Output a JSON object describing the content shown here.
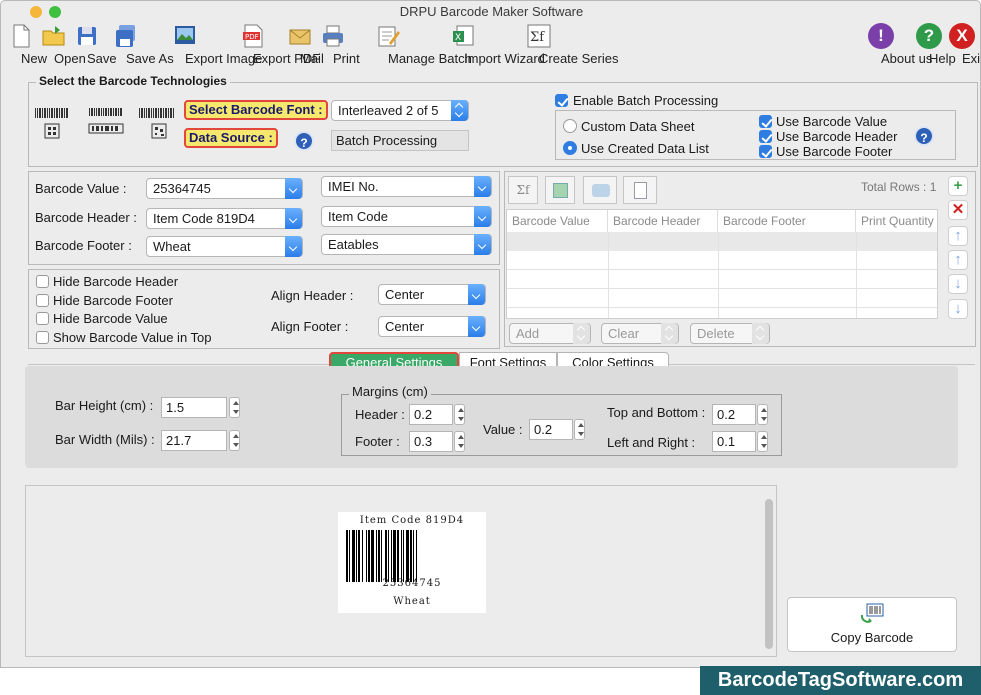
{
  "window": {
    "title": "DRPU Barcode Maker Software"
  },
  "toolbar": {
    "new": "New",
    "open": "Open",
    "save": "Save",
    "save_as": "Save As",
    "export_image": "Export Image",
    "export_pdf": "Export PDF",
    "mail": "Mail",
    "print": "Print",
    "manage_batch": "Manage Batch",
    "import_wizard": "Import Wizard",
    "create_series": "Create Series",
    "about_us": "About us",
    "help": "Help",
    "exit": "Exit"
  },
  "technologies": {
    "title": "Select the Barcode Technologies",
    "font_label": "Select Barcode Font :",
    "font_value": "Interleaved 2 of 5",
    "source_label": "Data Source :",
    "source_value": "Batch Processing",
    "help_glyph": "?"
  },
  "batch": {
    "enable_label": "Enable Batch Processing",
    "enable_checked": true,
    "custom_sheet": "Custom Data Sheet",
    "created_list": "Use Created Data List",
    "use_value": "Use Barcode Value",
    "use_header": "Use Barcode Header",
    "use_footer": "Use Barcode Footer"
  },
  "fields": {
    "value_label": "Barcode Value :",
    "value": "25364745",
    "value_type": "IMEI No.",
    "header_label": "Barcode Header :",
    "header": "Item Code 819D4",
    "header_type": "Item Code",
    "footer_label": "Barcode Footer :",
    "footer": "Wheat",
    "footer_type": "Eatables"
  },
  "options": {
    "hide_header": "Hide Barcode Header",
    "hide_footer": "Hide Barcode Footer",
    "hide_value": "Hide Barcode Value",
    "show_top": "Show Barcode Value in Top",
    "align_header_label": "Align Header :",
    "align_header": "Center",
    "align_footer_label": "Align Footer :",
    "align_footer": "Center"
  },
  "grid": {
    "total_rows": "Total Rows : 1",
    "columns": [
      "Barcode Value",
      "Barcode Header",
      "Barcode Footer",
      "Print Quantity"
    ],
    "add": "Add",
    "clear": "Clear",
    "delete": "Delete"
  },
  "tabs": [
    "General Settings",
    "Font Settings",
    "Color Settings"
  ],
  "general": {
    "bar_height_label": "Bar Height (cm) :",
    "bar_height": "1.5",
    "bar_width_label": "Bar Width (Mils) :",
    "bar_width": "21.7",
    "margins_title": "Margins (cm)",
    "m_header_label": "Header :",
    "m_header": "0.2",
    "m_footer_label": "Footer :",
    "m_footer": "0.3",
    "m_value_label": "Value :",
    "m_value": "0.2",
    "m_tb_label": "Top and Bottom :",
    "m_tb": "0.2",
    "m_lr_label": "Left and Right :",
    "m_lr": "0.1"
  },
  "preview": {
    "header": "Item Code 819D4",
    "value": "25364745",
    "footer": "Wheat",
    "copy_button": "Copy Barcode"
  },
  "watermark": "BarcodeTagSoftware.com",
  "colors": {
    "accent": "#2f7de1",
    "tab_active": "#3aa866",
    "highlight": "#f5e86c",
    "watermark_bg": "#1f5f6b"
  }
}
